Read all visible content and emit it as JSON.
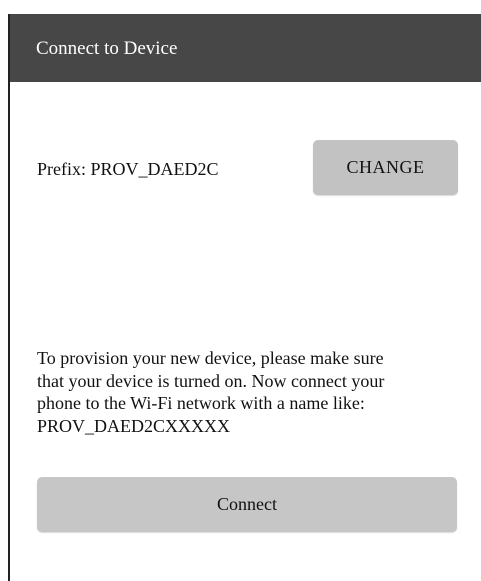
{
  "app_bar": {
    "title": "Connect to Device"
  },
  "prefix": {
    "label": "Prefix: PROV_DAED2C",
    "change_label": "CHANGE"
  },
  "instructions": {
    "lines": [
      "To provision your new device, please make sure",
      "that your device is turned on. Now connect your",
      "phone to the Wi-Fi network with a name like:",
      "PROV_DAED2CXXXXX"
    ]
  },
  "connect": {
    "label": "Connect"
  },
  "colors": {
    "app_bar_background": "#474747",
    "button_background": "#c2c2c2"
  }
}
